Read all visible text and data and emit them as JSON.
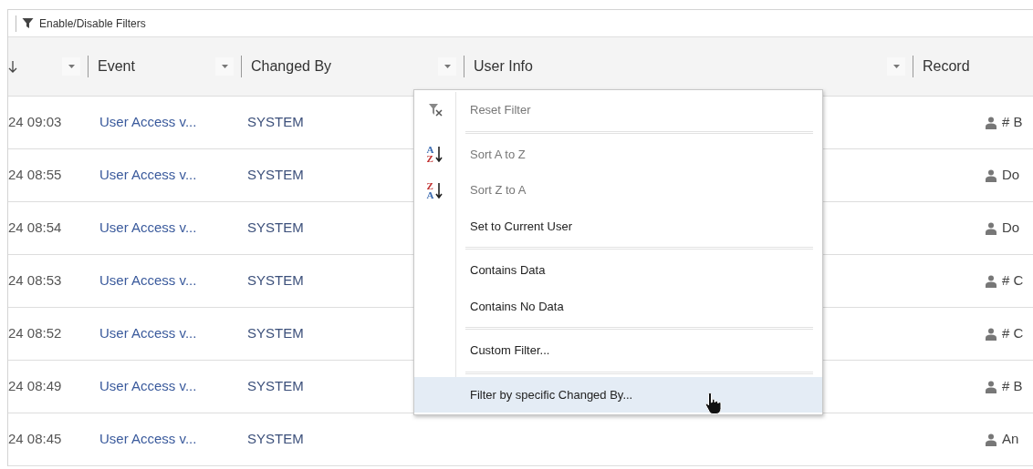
{
  "toolbar": {
    "filter_toggle": "Enable/Disable Filters"
  },
  "table": {
    "columns": [
      {
        "sorted_descending": true
      },
      {
        "label": "Event"
      },
      {
        "label": "Changed By"
      },
      {
        "label": "User Info"
      },
      {
        "label": "Record"
      }
    ],
    "rows": [
      {
        "date": "24 09:03",
        "event": "User Access v...",
        "changed_by": "SYSTEM",
        "record": "# B"
      },
      {
        "date": "24 08:55",
        "event": "User Access v...",
        "changed_by": "SYSTEM",
        "record": "Do"
      },
      {
        "date": "24 08:54",
        "event": "User Access v...",
        "changed_by": "SYSTEM",
        "record": "Do"
      },
      {
        "date": "24 08:53",
        "event": "User Access v...",
        "changed_by": "SYSTEM",
        "record": "# C"
      },
      {
        "date": "24 08:52",
        "event": "User Access v...",
        "changed_by": "SYSTEM",
        "record": "# C"
      },
      {
        "date": "24 08:49",
        "event": "User Access v...",
        "changed_by": "SYSTEM",
        "record": "# B"
      },
      {
        "date": "24 08:45",
        "event": "User Access v...",
        "changed_by": "SYSTEM",
        "record": "An"
      }
    ]
  },
  "filter_menu": {
    "groups": [
      [
        {
          "label": "Reset Filter",
          "kind": "reset",
          "disabled": true,
          "selected": false
        }
      ],
      [
        {
          "label": "Sort A to Z",
          "kind": "sort",
          "icon_letters": [
            "A",
            "Z"
          ],
          "disabled": true,
          "selected": false
        },
        {
          "label": "Sort Z to A",
          "kind": "sort",
          "icon_letters": [
            "Z",
            "A"
          ],
          "disabled": true,
          "selected": false
        },
        {
          "label": "Set to Current User",
          "disabled": false,
          "selected": false
        }
      ],
      [
        {
          "label": "Contains Data",
          "disabled": false,
          "selected": false
        },
        {
          "label": "Contains No Data",
          "disabled": false,
          "selected": false
        }
      ],
      [
        {
          "label": "Custom Filter...",
          "disabled": false,
          "selected": false
        }
      ],
      [
        {
          "label": "Filter by specific Changed By...",
          "disabled": false,
          "selected": true
        }
      ]
    ]
  }
}
